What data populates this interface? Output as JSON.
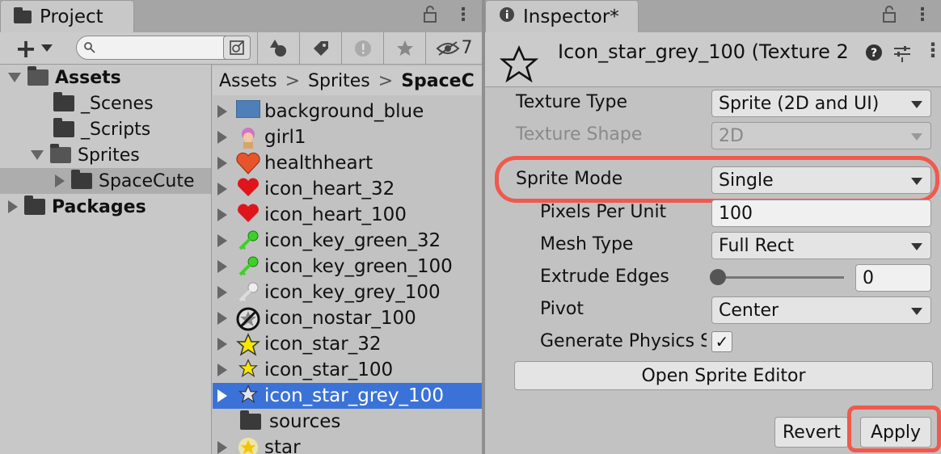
{
  "project": {
    "tab_label": "Project",
    "lock_glyph": "🔒",
    "menu_glyph": "⋮",
    "add_glyph": "+",
    "search_placeholder": "",
    "hidden_count": "7",
    "tree": [
      {
        "label": "Assets",
        "expanded": true
      },
      {
        "label": "_Scenes"
      },
      {
        "label": "_Scripts"
      },
      {
        "label": "Sprites",
        "expanded": true
      },
      {
        "label": "SpaceCute",
        "selected": true
      },
      {
        "label": "Packages"
      }
    ],
    "breadcrumb": [
      "Assets",
      ">",
      "Sprites",
      ">",
      "SpaceC"
    ],
    "files": [
      {
        "name": "background_blue",
        "icon": "blue-rectangle-icon"
      },
      {
        "name": "girl1",
        "icon": "girl-icon"
      },
      {
        "name": "healthheart",
        "icon": "orange-heart-icon"
      },
      {
        "name": "icon_heart_32",
        "icon": "red-heart-icon"
      },
      {
        "name": "icon_heart_100",
        "icon": "red-heart-icon"
      },
      {
        "name": "icon_key_green_32",
        "icon": "green-key-icon"
      },
      {
        "name": "icon_key_green_100",
        "icon": "green-key-icon"
      },
      {
        "name": "icon_key_grey_100",
        "icon": "grey-key-icon"
      },
      {
        "name": "icon_nostar_100",
        "icon": "no-star-icon"
      },
      {
        "name": "icon_star_32",
        "icon": "yellow-star-icon"
      },
      {
        "name": "icon_star_100",
        "icon": "yellow-star-icon"
      },
      {
        "name": "icon_star_grey_100",
        "icon": "grey-star-icon",
        "selected": true
      },
      {
        "name": "sources",
        "icon": "folder-icon"
      },
      {
        "name": "star",
        "icon": "glow-star-icon"
      }
    ]
  },
  "inspector": {
    "tab_label": "Inspector*",
    "lock_glyph": "🔒",
    "menu_glyph": "⋮",
    "asset_title": "Icon_star_grey_100 (Texture 2",
    "help_glyph": "?",
    "settings_glyph": "⚙",
    "props": {
      "texture_type_label": "Texture Type",
      "texture_type_value": "Sprite (2D and UI)",
      "texture_shape_label": "Texture Shape",
      "texture_shape_value": "2D",
      "sprite_mode_label": "Sprite Mode",
      "sprite_mode_value": "Single",
      "ppu_label": "Pixels Per Unit",
      "ppu_value": "100",
      "mesh_type_label": "Mesh Type",
      "mesh_type_value": "Full Rect",
      "extrude_label": "Extrude Edges",
      "extrude_value": "0",
      "extrude_level": 0,
      "pivot_label": "Pivot",
      "pivot_value": "Center",
      "physics_label": "Generate Physics S",
      "physics_checked": true,
      "check_glyph": "✓"
    },
    "open_sprite_editor_label": "Open Sprite Editor",
    "revert_label": "Revert",
    "apply_label": "Apply"
  },
  "colors": {
    "selection": "#3a72d8",
    "highlight": "#f0594d"
  }
}
